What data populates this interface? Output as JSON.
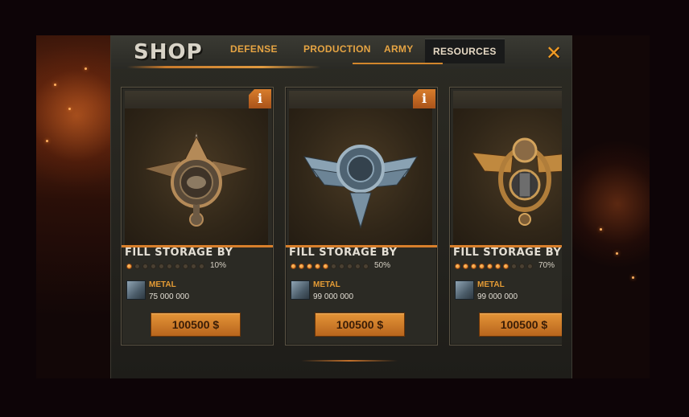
{
  "header": {
    "title": "SHOP",
    "tabs": [
      {
        "label": "DEFENSE",
        "active": false
      },
      {
        "label": "PRODUCTION",
        "active": false
      },
      {
        "label": "ARMY",
        "active": false
      },
      {
        "label": "RESOURCES",
        "active": true
      }
    ],
    "close_icon": "close-x-icon"
  },
  "cards": [
    {
      "title": "FILL STORAGE BY",
      "progress_percent": 10,
      "progress_label": "10%",
      "resource_name": "METAL",
      "resource_amount": "75 000 000",
      "price": "100500 $",
      "info_label": "i",
      "emblem": "bronze-eagle-badge"
    },
    {
      "title": "FILL STORAGE BY",
      "progress_percent": 50,
      "progress_label": "50%",
      "resource_name": "METAL",
      "resource_amount": "99 000 000",
      "price": "100500 $",
      "info_label": "i",
      "emblem": "steel-winged-badge"
    },
    {
      "title": "FILL STORAGE BY",
      "progress_percent": 70,
      "progress_label": "70%",
      "resource_name": "METAL",
      "resource_amount": "99 000 000",
      "price": "100500 $",
      "emblem": "golden-laurel-badge"
    }
  ],
  "colors": {
    "accent": "#e6a443",
    "button": "#d88a32",
    "background": "#0d0407"
  }
}
